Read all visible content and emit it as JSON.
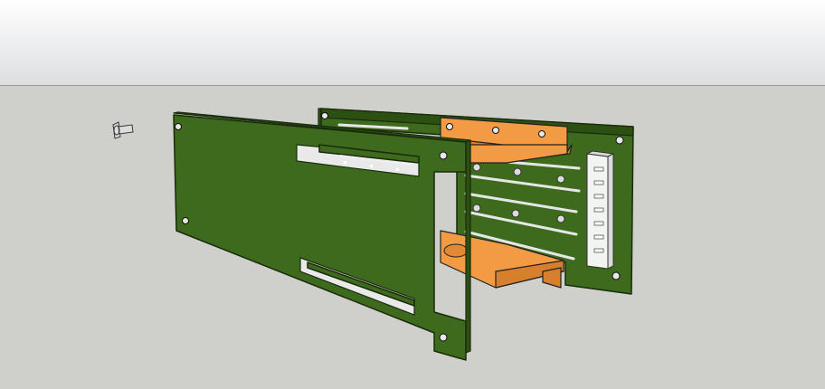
{
  "viewport": {
    "sky_top_color": "#ffffff",
    "sky_bottom_color": "#dcdee0",
    "ground_color": "#cfcfcb",
    "horizon_line_color": "#9a9a96"
  },
  "model": {
    "panel_color": "#3d6a1c",
    "panel_edge_color": "#1a2b0c",
    "panel_side_color": "#2c4f12",
    "bracket_color": "#f39a45",
    "bracket_shade_color": "#d67f2c",
    "connector_color": "#f2f4f2",
    "rail_color": "#e6e6e6",
    "screw_color": "#dcdcdc"
  },
  "components": [
    "front-panel",
    "rear-panel",
    "upper-bracket",
    "lower-bracket",
    "card-rails",
    "edge-connector",
    "loose-screw"
  ]
}
